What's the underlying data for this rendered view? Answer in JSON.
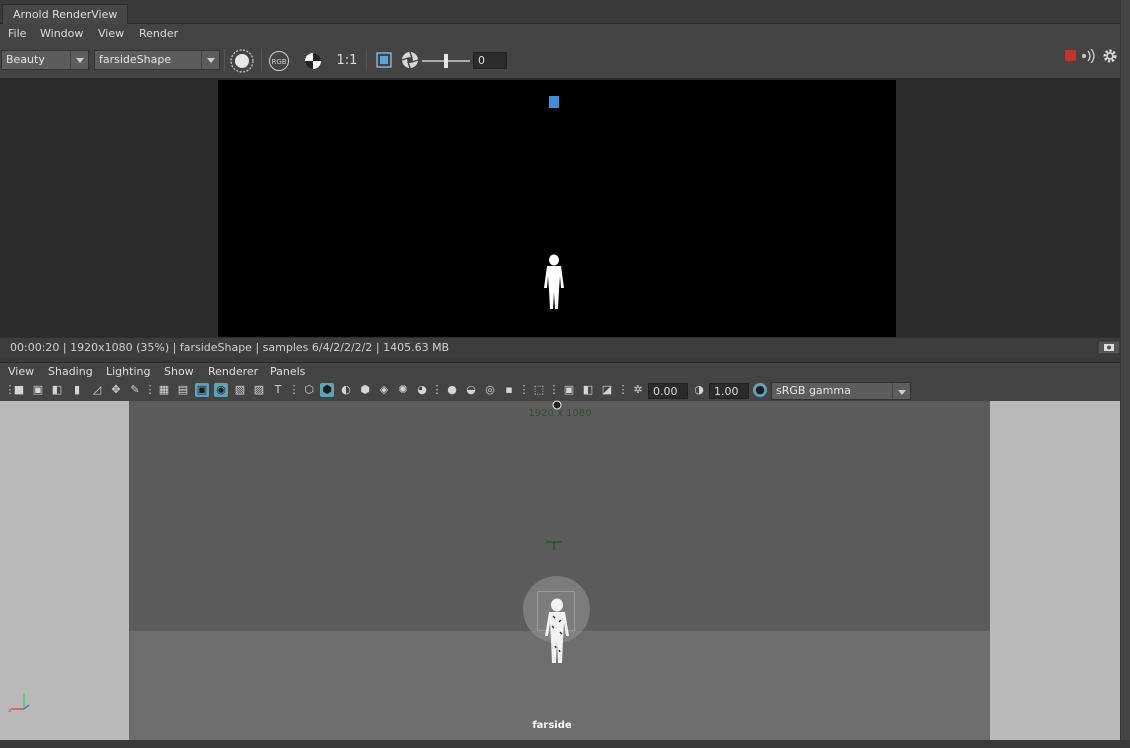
{
  "window": {
    "tab_title": "Arnold RenderView"
  },
  "renderview": {
    "menu": [
      "File",
      "Window",
      "View",
      "Render"
    ],
    "aov_select": "Beauty",
    "camera_select": "farsideShape",
    "icons": {
      "render": "record-circle-icon",
      "rgb": "RGB",
      "alpha": "alpha-checker-icon",
      "zoom": "1:1",
      "region": "crop-region-icon",
      "exposure": "aperture-icon"
    },
    "exposure_value": "0",
    "status_text": "00:00:20 | 1920x1080 (35%) | farsideShape  | samples 6/4/2/2/2/2 | 1405.63 MB",
    "colors": {
      "stop": "#c8302c",
      "selection": "#3f8fd8"
    }
  },
  "viewport": {
    "menu": [
      "View",
      "Shading",
      "Lighting",
      "Show",
      "Renderer",
      "Panels"
    ],
    "exposure_field": "0.00",
    "gamma_field": "1.00",
    "colorspace_select": "sRGB gamma",
    "resolution_label": "1920 x 1080",
    "camera_label": "farside",
    "colors": {
      "accent": "#5ea2b8",
      "gate_text": "#1f5a2a"
    }
  }
}
